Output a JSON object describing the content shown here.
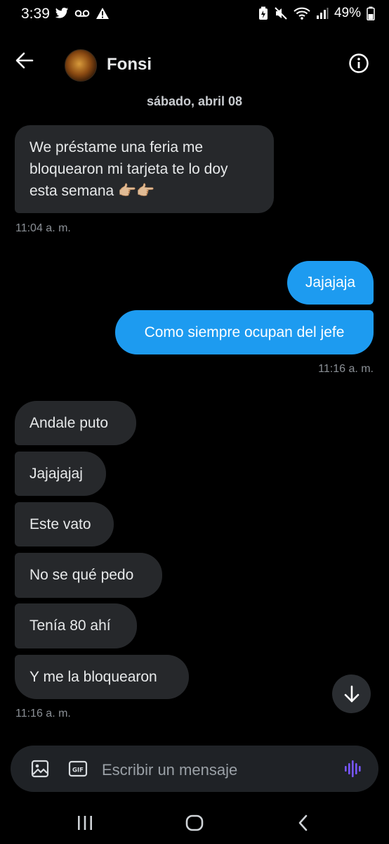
{
  "status_bar": {
    "time": "3:39",
    "battery": "49%",
    "left_icons": [
      "twitter-icon",
      "voicemail-icon",
      "warning-icon"
    ],
    "right_icons": [
      "battery-saver-icon",
      "mute-icon",
      "wifi-icon",
      "signal-icon",
      "battery-icon"
    ]
  },
  "header": {
    "contact_name": "Fonsi",
    "back_icon": "arrow-left-icon",
    "info_icon": "info-icon"
  },
  "conversation": {
    "date_separator": "sábado, abril 08",
    "messages": [
      {
        "dir": "in",
        "lines": [
          "We préstame una feria me",
          "bloquearon mi tarjeta te lo doy",
          "esta semana 👉🏼👉🏼"
        ]
      },
      {
        "dir": "in_time",
        "text": "11:04 a. m."
      },
      {
        "dir": "out",
        "text": "Jajajaja"
      },
      {
        "dir": "out",
        "text": "Como siempre ocupan del jefe"
      },
      {
        "dir": "out_time",
        "text": "11:16 a. m."
      },
      {
        "dir": "in",
        "text": "Andale puto"
      },
      {
        "dir": "in",
        "text": "Jajajajaj"
      },
      {
        "dir": "in",
        "text": "Este vato"
      },
      {
        "dir": "in",
        "text": "No se qué pedo"
      },
      {
        "dir": "in",
        "text": "Tenía 80 ahí"
      },
      {
        "dir": "in",
        "text": "Y me la bloquearon"
      },
      {
        "dir": "in_time",
        "text": "11:16 a. m."
      }
    ]
  },
  "msg": {
    "m1_l1": "We préstame una feria me",
    "m1_l2": "bloquearon mi tarjeta te lo doy",
    "m1_l3": "esta semana 👉🏼👉🏼",
    "t1": "11:04 a. m.",
    "o1": "Jajajaja",
    "o2": "Como siempre ocupan del jefe",
    "t2": "11:16 a. m.",
    "i1": "Andale puto",
    "i2": "Jajajajaj",
    "i3": "Este vato",
    "i4": "No se qué pedo",
    "i5": "Tenía 80 ahí",
    "i6": "Y me la bloquearon",
    "t3": "11:16 a. m."
  },
  "composer": {
    "placeholder": "Escribir un mensaje",
    "image_icon": "image-icon",
    "gif_label": "GIF",
    "voice_icon": "voice-wave-icon"
  },
  "nav_bar": {
    "buttons": [
      "recents-icon",
      "home-icon",
      "back-icon"
    ]
  },
  "colors": {
    "background": "#000000",
    "incoming_bubble": "#26282b",
    "outgoing_bubble": "#1d9bf0",
    "voice_accent": "#7856ff"
  }
}
